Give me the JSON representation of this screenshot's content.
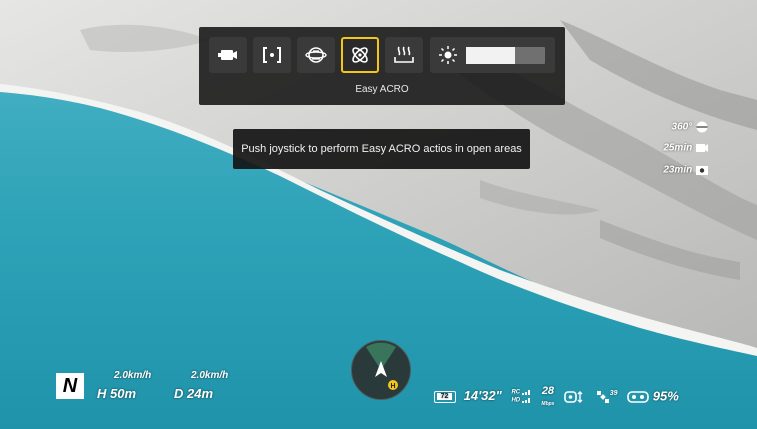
{
  "toolbar": {
    "buttons": [
      {
        "name": "record-mode",
        "icon": "video-camera-icon"
      },
      {
        "name": "focus-frame",
        "icon": "focus-bracket-icon"
      },
      {
        "name": "horizon-globe",
        "icon": "globe-horizon-icon"
      },
      {
        "name": "easy-acro",
        "icon": "acro-orbit-icon",
        "active": true
      },
      {
        "name": "heating",
        "icon": "heat-wave-icon"
      }
    ],
    "brightness_level": 0.62,
    "mode_label": "Easy ACRO"
  },
  "toast": {
    "message": "Push joystick to perform Easy ACRO actios in open areas"
  },
  "right_panel": {
    "rotation": "360°",
    "video_time": "25min",
    "photo_time": "23min"
  },
  "flight": {
    "mode_badge": "N",
    "h_speed": "2.0km/h",
    "v_speed": "2.0km/h",
    "height_prefix": "H",
    "height": "50m",
    "distance_prefix": "D",
    "distance": "24m"
  },
  "status_bar": {
    "battery_label": "72",
    "flight_time": "14'32\"",
    "rc_label": "RC",
    "hd_label": "HD",
    "bitrate": "28",
    "bitrate_unit": "Mbps",
    "satellites": "39",
    "goggles_battery": "95%"
  },
  "colors": {
    "active_border": "#f4c618",
    "compass_home": "#f4c618",
    "sea": "#2fa3b8"
  }
}
